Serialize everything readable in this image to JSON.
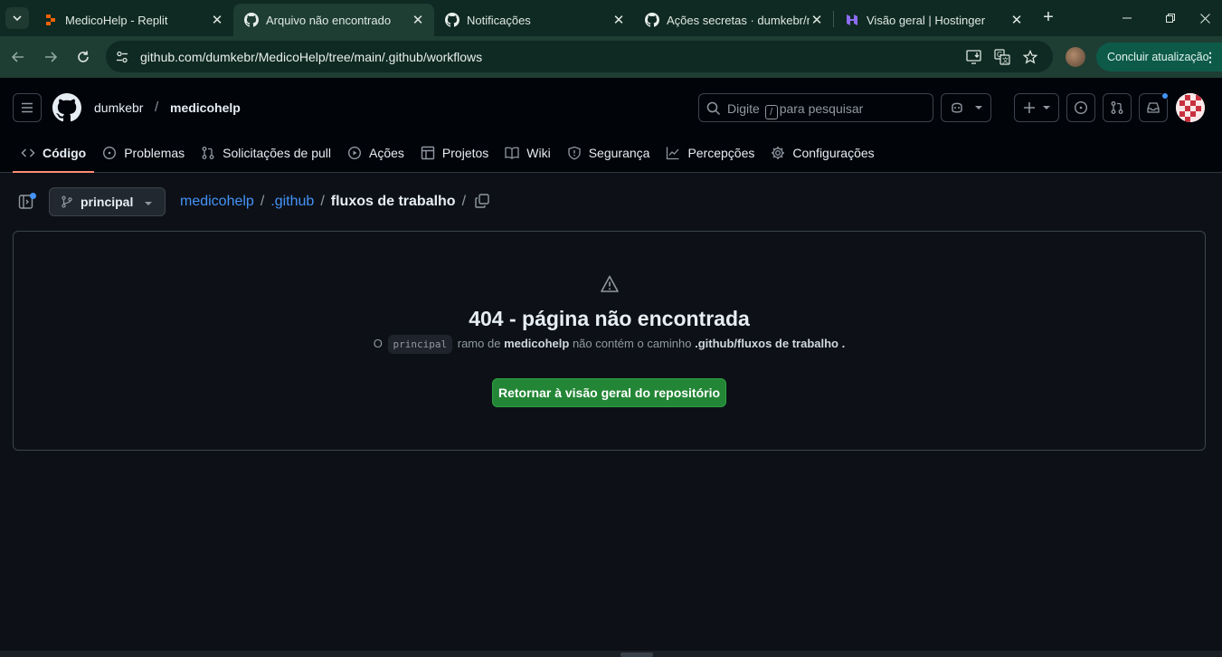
{
  "browser": {
    "tabs": [
      {
        "title": "MedicoHelp - Replit",
        "favicon": "replit-icon",
        "active": false
      },
      {
        "title": "Arquivo não encontrado",
        "favicon": "github-icon",
        "active": true
      },
      {
        "title": "Notificações",
        "favicon": "github-icon",
        "active": false
      },
      {
        "title": "Ações secretas · dumkebr/m",
        "favicon": "github-icon",
        "active": false
      },
      {
        "title": "Visão geral | Hostinger",
        "favicon": "hostinger-icon",
        "active": false
      }
    ],
    "url": "github.com/dumkebr/MedicoHelp/tree/main/.github/workflows",
    "update_button": "Concluir atualização",
    "colors": {
      "frame": "#0f2a22",
      "toolbar": "#1e3d33",
      "update": "#0e5a49"
    }
  },
  "github": {
    "owner": "dumkebr",
    "repo": "medicohelp",
    "search_placeholder_before": "Digite",
    "search_key": "/",
    "search_placeholder_after": "para pesquisar",
    "nav": [
      {
        "label": "Código",
        "icon": "code-icon",
        "selected": true
      },
      {
        "label": "Problemas",
        "icon": "issue-icon",
        "selected": false
      },
      {
        "label": "Solicitações de pull",
        "icon": "pull-request-icon",
        "selected": false
      },
      {
        "label": "Ações",
        "icon": "play-icon",
        "selected": false
      },
      {
        "label": "Projetos",
        "icon": "table-icon",
        "selected": false
      },
      {
        "label": "Wiki",
        "icon": "book-icon",
        "selected": false
      },
      {
        "label": "Segurança",
        "icon": "shield-icon",
        "selected": false
      },
      {
        "label": "Percepções",
        "icon": "graph-icon",
        "selected": false
      },
      {
        "label": "Configurações",
        "icon": "gear-icon",
        "selected": false
      }
    ],
    "colors": {
      "accent_blue": "#4493f8",
      "tab_underline": "#fd8c73",
      "primary_button": "#238636"
    }
  },
  "page": {
    "branch": "principal",
    "breadcrumb": {
      "repo": "medicohelp",
      "folder": ".github",
      "current": "fluxos de trabalho",
      "separator": "/"
    },
    "error": {
      "title": "404 - página não encontrada",
      "msg_prefix": "O",
      "msg_branch": "principal",
      "msg_middle": "ramo de",
      "msg_repo": "medicohelp",
      "msg_middle2": "não contém o caminho",
      "msg_path": ".github/fluxos de trabalho",
      "msg_suffix": ".",
      "button": "Retornar à visão geral do repositório"
    }
  }
}
